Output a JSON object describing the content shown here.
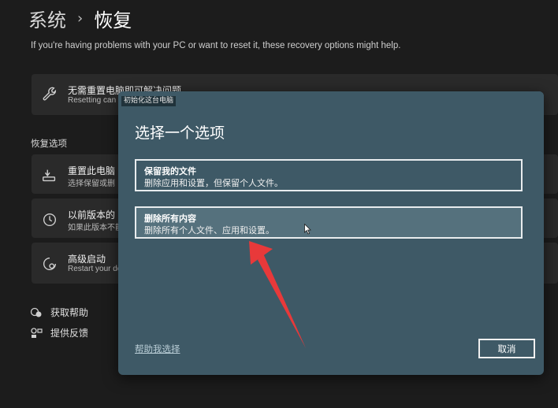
{
  "breadcrumb": {
    "parent": "系统",
    "separator": "›",
    "current": "恢复"
  },
  "intro": "If you're having problems with your PC or want to reset it, these recovery options might help.",
  "fix_card": {
    "title": "无需重置电脑即可解决问题",
    "subtitle": "Resetting can"
  },
  "section_label": "恢复选项",
  "recovery_items": [
    {
      "title": "重置此电脑",
      "subtitle": "选择保留或删",
      "icon": "reset-pc-icon"
    },
    {
      "title": "以前版本的 W",
      "subtitle": "如果此版本不能",
      "icon": "history-icon"
    },
    {
      "title": "高级启动",
      "subtitle": "Restart your de",
      "icon": "advanced-startup-icon"
    }
  ],
  "links": {
    "help": "获取帮助",
    "feedback": "提供反馈"
  },
  "dialog": {
    "app_label": "初始化这台电脑",
    "heading": "选择一个选项",
    "options": [
      {
        "title": "保留我的文件",
        "subtitle": "删除应用和设置，但保留个人文件。"
      },
      {
        "title": "删除所有内容",
        "subtitle": "删除所有个人文件、应用和设置。"
      }
    ],
    "help_link": "帮助我选择",
    "cancel": "取消"
  },
  "annotation_color": "#e8393a"
}
